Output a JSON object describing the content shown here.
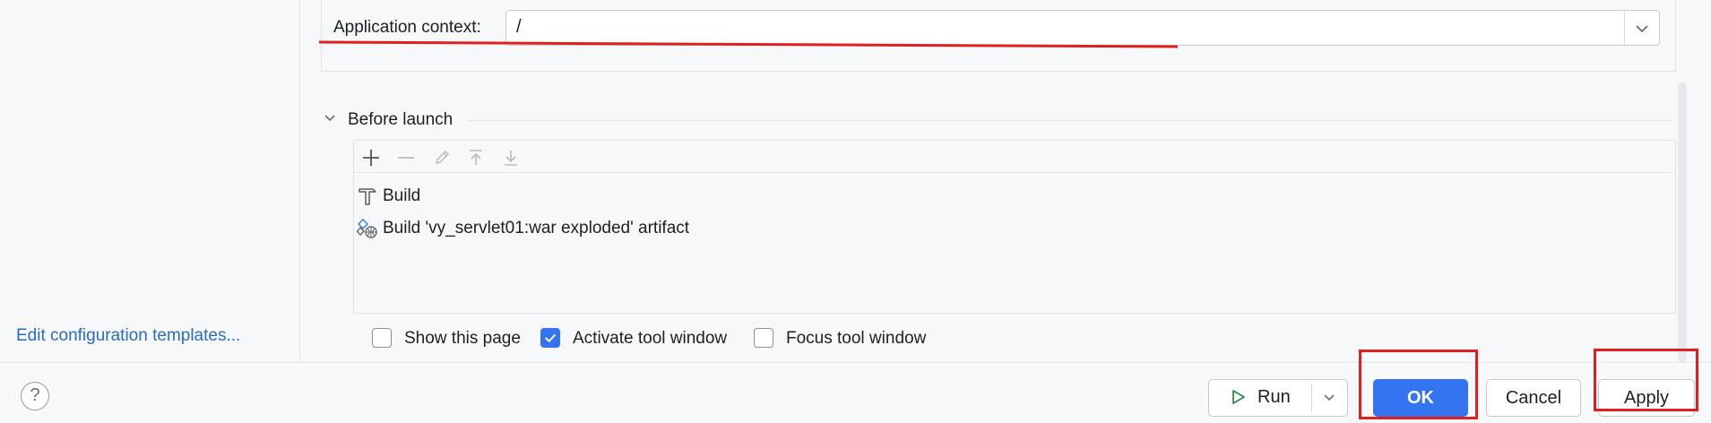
{
  "left_panel": {
    "edit_templates_link": "Edit configuration templates..."
  },
  "app_context": {
    "label": "Application context:",
    "value": "/"
  },
  "before_launch": {
    "title": "Before launch",
    "toolbar": {
      "icons": [
        "add-icon",
        "remove-icon",
        "edit-icon",
        "move-up-icon",
        "move-down-icon"
      ]
    },
    "tasks": [
      {
        "label": "Build",
        "icon": "hammer-icon"
      },
      {
        "label": "Build 'vy_servlet01:war exploded' artifact",
        "icon": "artifact-icon"
      }
    ]
  },
  "options": [
    {
      "label": "Show this page",
      "checked": false
    },
    {
      "label": "Activate tool window",
      "checked": true
    },
    {
      "label": "Focus tool window",
      "checked": false
    }
  ],
  "footer": {
    "help": "?",
    "run_label": "Run",
    "ok_label": "OK",
    "cancel_label": "Cancel",
    "apply_label": "Apply"
  },
  "colors": {
    "accent": "#3574f0",
    "annotation": "#e0201f",
    "link": "#2a6bc2"
  }
}
